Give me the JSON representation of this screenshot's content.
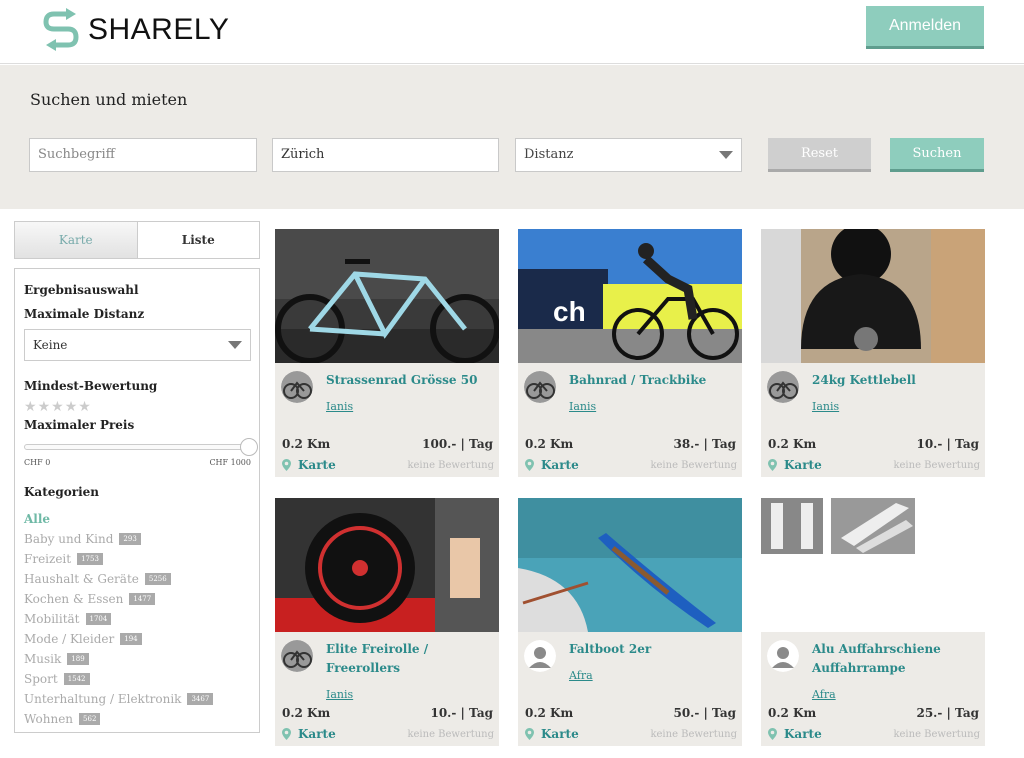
{
  "header": {
    "brand": "SHARELY",
    "login_label": "Anmelden"
  },
  "search": {
    "title": "Suchen und mieten",
    "term_placeholder": "Suchbegriff",
    "location_value": "Zürich",
    "distance_label": "Distanz",
    "reset_label": "Reset",
    "search_label": "Suchen"
  },
  "view_toggle": {
    "map_label": "Karte",
    "list_label": "Liste"
  },
  "filters": {
    "heading": "Ergebnisauswahl",
    "max_distance_label": "Maximale Distanz",
    "max_distance_value": "Keine",
    "min_rating_label": "Mindest-Bewertung",
    "rating_stars": 5,
    "rating_selected": 0,
    "max_price_label": "Maximaler Preis",
    "price_min_label": "CHF 0",
    "price_max_label": "CHF 1000",
    "price_level_fraction": 1.0,
    "categories_label": "Kategorien",
    "categories": [
      {
        "label": "Alle",
        "count": "",
        "active": true
      },
      {
        "label": "Baby und Kind",
        "count": "293"
      },
      {
        "label": "Freizeit",
        "count": "1753"
      },
      {
        "label": "Haushalt & Geräte",
        "count": "5256"
      },
      {
        "label": "Kochen & Essen",
        "count": "1477"
      },
      {
        "label": "Mobilität",
        "count": "1704"
      },
      {
        "label": "Mode / Kleider",
        "count": "194"
      },
      {
        "label": "Musik",
        "count": "189"
      },
      {
        "label": "Sport",
        "count": "1542"
      },
      {
        "label": "Unterhaltung / Elektronik",
        "count": "3467"
      },
      {
        "label": "Wohnen",
        "count": "562"
      }
    ]
  },
  "listings": [
    {
      "title": "Strassenrad Grösse 50",
      "owner": "Ianis",
      "distance": "0.2 Km",
      "price": "100.- | Tag",
      "map_label": "Karte",
      "rating": "keine Bewertung"
    },
    {
      "title": "Bahnrad / Trackbike",
      "owner": "Ianis",
      "distance": "0.2 Km",
      "price": "38.- | Tag",
      "map_label": "Karte",
      "rating": "keine Bewertung"
    },
    {
      "title": "24kg Kettlebell",
      "owner": "Ianis",
      "distance": "0.2 Km",
      "price": "10.- | Tag",
      "map_label": "Karte",
      "rating": "keine Bewertung"
    },
    {
      "title": "Elite Freirolle / Freerollers",
      "owner": "Ianis",
      "distance": "0.2 Km",
      "price": "10.- | Tag",
      "map_label": "Karte",
      "rating": "keine Bewertung"
    },
    {
      "title": "Faltboot 2er",
      "owner": "Afra",
      "distance": "0.2 Km",
      "price": "50.- | Tag",
      "map_label": "Karte",
      "rating": "keine Bewertung"
    },
    {
      "title": "Alu Auffahrschiene Auffahrrampe",
      "owner": "Afra",
      "distance": "0.2 Km",
      "price": "25.- | Tag",
      "map_label": "Karte",
      "rating": "keine Bewertung"
    }
  ],
  "colors": {
    "accent": "#8ecdbd",
    "link": "#2b8a8a",
    "band": "#edebe7"
  }
}
